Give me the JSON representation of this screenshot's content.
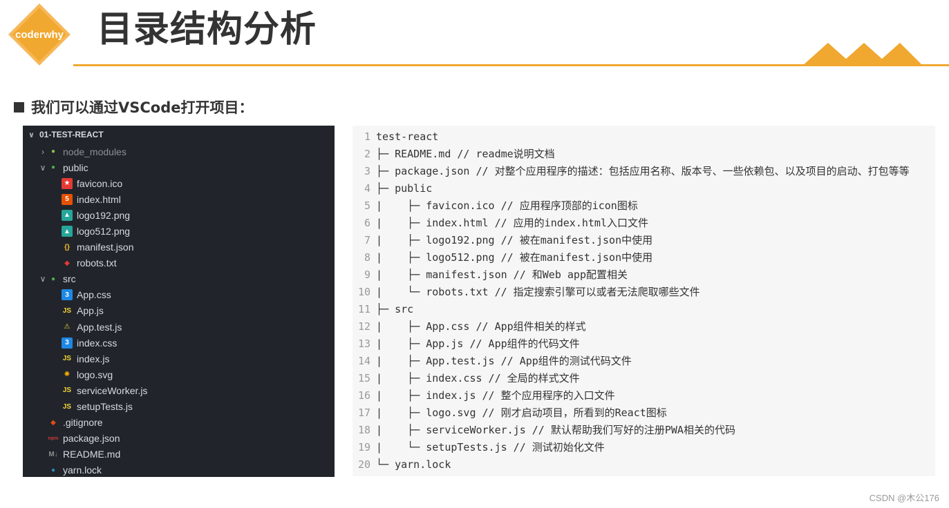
{
  "header": {
    "logo_text": "coderwhy",
    "title": "目录结构分析",
    "accent_color": "#f0a830"
  },
  "subtitle": "我们可以通过VSCode打开项目：",
  "explorer": {
    "root_label": "01-TEST-REACT",
    "items": [
      {
        "label": "node_modules",
        "kind": "folder",
        "expanded": false,
        "level": 0,
        "icon": "node-folder-icon",
        "dim": true
      },
      {
        "label": "public",
        "kind": "folder",
        "expanded": true,
        "level": 0,
        "icon": "public-folder-icon"
      },
      {
        "label": "favicon.ico",
        "kind": "file",
        "level": 1,
        "icon": "favicon-icon"
      },
      {
        "label": "index.html",
        "kind": "file",
        "level": 1,
        "icon": "html-icon"
      },
      {
        "label": "logo192.png",
        "kind": "file",
        "level": 1,
        "icon": "image-icon"
      },
      {
        "label": "logo512.png",
        "kind": "file",
        "level": 1,
        "icon": "image-icon"
      },
      {
        "label": "manifest.json",
        "kind": "file",
        "level": 1,
        "icon": "json-icon"
      },
      {
        "label": "robots.txt",
        "kind": "file",
        "level": 1,
        "icon": "robot-icon"
      },
      {
        "label": "src",
        "kind": "folder",
        "expanded": true,
        "level": 0,
        "icon": "src-folder-icon"
      },
      {
        "label": "App.css",
        "kind": "file",
        "level": 1,
        "icon": "css-icon"
      },
      {
        "label": "App.js",
        "kind": "file",
        "level": 1,
        "icon": "js-icon"
      },
      {
        "label": "App.test.js",
        "kind": "file",
        "level": 1,
        "icon": "test-icon"
      },
      {
        "label": "index.css",
        "kind": "file",
        "level": 1,
        "icon": "css-icon"
      },
      {
        "label": "index.js",
        "kind": "file",
        "level": 1,
        "icon": "js-icon"
      },
      {
        "label": "logo.svg",
        "kind": "file",
        "level": 1,
        "icon": "svg-icon"
      },
      {
        "label": "serviceWorker.js",
        "kind": "file",
        "level": 1,
        "icon": "js-icon"
      },
      {
        "label": "setupTests.js",
        "kind": "file",
        "level": 1,
        "icon": "js-icon"
      },
      {
        "label": ".gitignore",
        "kind": "file",
        "level": 0,
        "icon": "git-icon"
      },
      {
        "label": "package.json",
        "kind": "file",
        "level": 0,
        "icon": "npm-icon"
      },
      {
        "label": "README.md",
        "kind": "file",
        "level": 0,
        "icon": "markdown-icon"
      },
      {
        "label": "yarn.lock",
        "kind": "file",
        "level": 0,
        "icon": "yarn-icon"
      }
    ]
  },
  "code_lines": [
    "test-react",
    "├─ README.md // readme说明文档",
    "├─ package.json // 对整个应用程序的描述：包括应用名称、版本号、一些依赖包、以及项目的启动、打包等等",
    "├─ public",
    "|    ├─ favicon.ico // 应用程序顶部的icon图标",
    "|    ├─ index.html // 应用的index.html入口文件",
    "|    ├─ logo192.png // 被在manifest.json中使用",
    "|    ├─ logo512.png // 被在manifest.json中使用",
    "|    ├─ manifest.json // 和Web app配置相关",
    "|    └─ robots.txt // 指定搜索引擎可以或者无法爬取哪些文件",
    "├─ src",
    "|    ├─ App.css // App组件相关的样式",
    "|    ├─ App.js // App组件的代码文件",
    "|    ├─ App.test.js // App组件的测试代码文件",
    "|    ├─ index.css // 全局的样式文件",
    "|    ├─ index.js // 整个应用程序的入口文件",
    "|    ├─ logo.svg // 刚才启动项目，所看到的React图标",
    "|    ├─ serviceWorker.js // 默认帮助我们写好的注册PWA相关的代码",
    "|    └─ setupTests.js // 测试初始化文件",
    "└─ yarn.lock"
  ],
  "line_numbers": [
    "1",
    "2",
    "3",
    "4",
    "5",
    "6",
    "7",
    "8",
    "9",
    "10",
    "11",
    "12",
    "13",
    "14",
    "15",
    "16",
    "17",
    "18",
    "19",
    "20"
  ],
  "watermark": "CSDN @木公176"
}
